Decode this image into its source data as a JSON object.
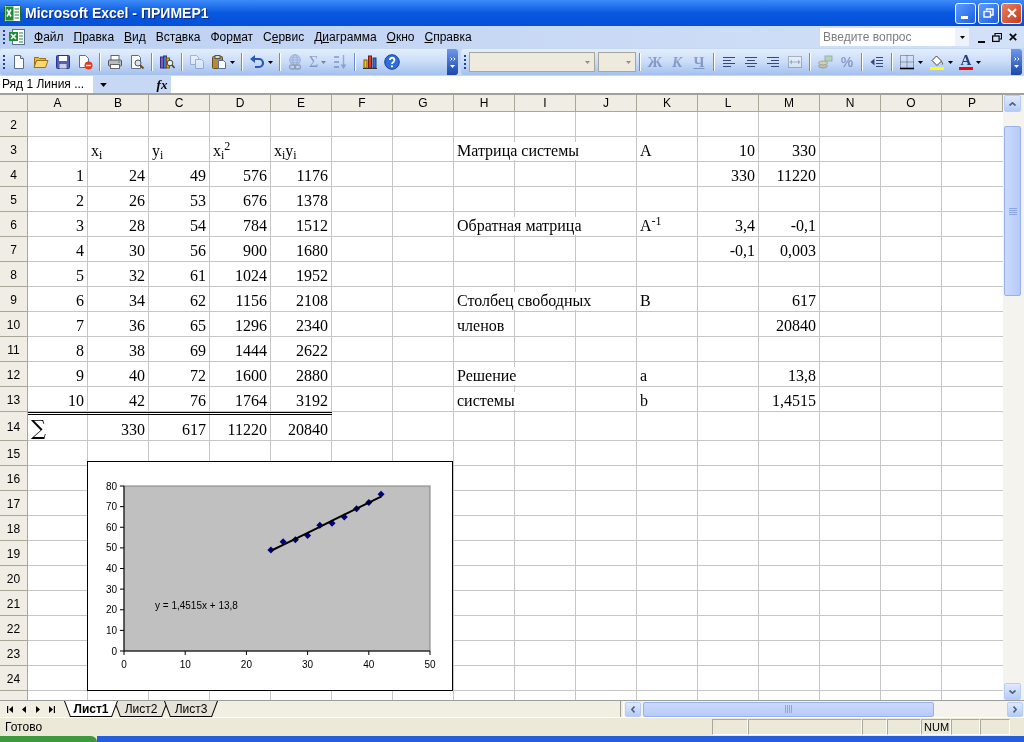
{
  "window": {
    "title": "Microsoft Excel - ПРИМЕР1"
  },
  "menu_bar": {
    "items": [
      {
        "key": "Ф",
        "post": "айл"
      },
      {
        "key": "П",
        "post": "равка"
      },
      {
        "key": "В",
        "post": "ид"
      },
      {
        "pre": "Вст",
        "key": "а",
        "post": "вка"
      },
      {
        "pre": "Фор",
        "key": "м",
        "post": "ат"
      },
      {
        "pre": "С",
        "key": "е",
        "post": "рвис"
      },
      {
        "pre": "Д",
        "key": "и",
        "post": "аграмма"
      },
      {
        "key": "О",
        "post": "кно"
      },
      {
        "key": "С",
        "post": "правка"
      }
    ],
    "question": {
      "placeholder": "Введите вопрос"
    }
  },
  "standard_toolbar": {
    "groups": [
      [
        {
          "disabled": false,
          "dropdown": false
        },
        {
          "disabled": false,
          "dropdown": false
        },
        {
          "disabled": false,
          "dropdown": false
        },
        {
          "disabled": false,
          "dropdown": false
        }
      ],
      [
        {
          "disabled": false,
          "dropdown": false
        },
        {
          "disabled": false,
          "dropdown": false
        }
      ],
      [
        {
          "disabled": false,
          "dropdown": false
        }
      ],
      [
        {
          "disabled": true,
          "dropdown": false
        },
        {
          "disabled": false,
          "dropdown": true
        }
      ],
      [
        {
          "disabled": false,
          "dropdown": true
        }
      ],
      [
        {
          "disabled": true,
          "dropdown": false
        },
        {
          "disabled": true,
          "dropdown": true,
          "label": "Σ"
        },
        {
          "disabled": true,
          "dropdown": false
        }
      ],
      [
        {
          "disabled": false,
          "dropdown": false
        },
        {
          "disabled": false,
          "dropdown": false
        }
      ]
    ]
  },
  "formatting_toolbar": {
    "font_name": {
      "disabled": true
    },
    "font_size": {
      "disabled": true
    },
    "groups": [
      [
        {
          "disabled": true,
          "dropdown": false,
          "label": "Ж"
        },
        {
          "disabled": true,
          "dropdown": false,
          "label": "К"
        },
        {
          "disabled": true,
          "dropdown": false,
          "label": "Ч"
        }
      ],
      [
        {
          "disabled": false,
          "dropdown": false
        },
        {
          "disabled": false,
          "dropdown": false
        },
        {
          "disabled": false,
          "dropdown": false
        },
        {
          "disabled": true,
          "dropdown": false
        }
      ],
      [
        {
          "disabled": true,
          "dropdown": false
        },
        {
          "disabled": true,
          "dropdown": false,
          "label": "%"
        }
      ],
      [
        {
          "disabled": false,
          "dropdown": false
        }
      ],
      [
        {
          "disabled": false,
          "dropdown": true
        },
        {
          "disabled": false,
          "dropdown": true
        },
        {
          "disabled": false,
          "dropdown": true,
          "label": "A"
        }
      ]
    ]
  },
  "formula_bar": {
    "name_box": "Ряд 1 Линия ...",
    "function_label": "fx"
  },
  "sheet": {
    "columns": [
      "A",
      "B",
      "C",
      "D",
      "E",
      "F",
      "G",
      "H",
      "I",
      "J",
      "K",
      "L",
      "M",
      "N",
      "O",
      "P"
    ],
    "rows": [
      "2",
      "3",
      "4",
      "5",
      "6",
      "7",
      "8",
      "9",
      "10",
      "11",
      "12",
      "13",
      "14",
      "15",
      "16",
      "17",
      "18",
      "19",
      "20",
      "21",
      "22",
      "23",
      "24"
    ]
  },
  "data_table": {
    "header": [
      "x$_{i}$",
      "y$_{i}$",
      "x$_{i}$$^{2}$",
      "x$_{i}$y$_{i}$"
    ],
    "rows": [
      [
        "1",
        "24",
        "49",
        "576",
        "1176"
      ],
      [
        "2",
        "26",
        "53",
        "676",
        "1378"
      ],
      [
        "3",
        "28",
        "54",
        "784",
        "1512"
      ],
      [
        "4",
        "30",
        "56",
        "900",
        "1680"
      ],
      [
        "5",
        "32",
        "61",
        "1024",
        "1952"
      ],
      [
        "6",
        "34",
        "62",
        "1156",
        "2108"
      ],
      [
        "7",
        "36",
        "65",
        "1296",
        "2340"
      ],
      [
        "8",
        "38",
        "69",
        "1444",
        "2622"
      ],
      [
        "9",
        "40",
        "72",
        "1600",
        "2880"
      ],
      [
        "10",
        "42",
        "76",
        "1764",
        "3192"
      ]
    ],
    "total": {
      "symbol": "∑",
      "values": [
        "330",
        "617",
        "11220",
        "20840"
      ]
    }
  },
  "system": [
    {
      "kind": "matrix",
      "label_lines": [
        "Матрица системы"
      ],
      "symbols": [
        "A"
      ],
      "rows": [
        [
          "10",
          "330"
        ],
        [
          "330",
          "11220"
        ]
      ]
    },
    {
      "kind": "matrix",
      "label_lines": [
        "Обратная матрица"
      ],
      "symbols": [
        "A$^{-1}$"
      ],
      "rows": [
        [
          "3,4",
          "-0,1"
        ],
        [
          "-0,1",
          "0,003"
        ]
      ]
    },
    {
      "kind": "vector",
      "label_lines": [
        "Столбец свободных",
        "членов"
      ],
      "symbols": [
        "B"
      ],
      "rows": [
        [
          "617"
        ],
        [
          "20840"
        ]
      ]
    },
    {
      "kind": "vector",
      "label_lines": [
        "Решение",
        "системы"
      ],
      "symbols": [
        "a",
        "b"
      ],
      "rows": [
        [
          "13,8"
        ],
        [
          "1,4515"
        ]
      ]
    }
  ],
  "chart": {
    "chart_data": {
      "type": "scatter",
      "x": [
        24,
        26,
        28,
        30,
        32,
        34,
        36,
        38,
        40,
        42
      ],
      "series": [
        {
          "type": "scatter",
          "color": "#000080",
          "values": [
            49,
            53,
            54,
            56,
            61,
            62,
            65,
            69,
            72,
            76
          ]
        },
        {
          "type": "line",
          "color": "#000000",
          "values": [
            48.6,
            51.5,
            54.4,
            57.3,
            60.2,
            63.2,
            66.1,
            69,
            71.9,
            74.8
          ]
        }
      ],
      "xlim": [
        0,
        50
      ],
      "ylim": [
        0,
        80
      ],
      "xticks": [
        0,
        10,
        20,
        30,
        40,
        50
      ],
      "yticks": [
        0,
        10,
        20,
        30,
        40,
        50,
        60,
        70,
        80
      ],
      "annotations": [
        "y = 1,4515x + 13,8"
      ]
    }
  },
  "sheet_tabs": [
    {
      "label": "Лист1",
      "selected": true
    },
    {
      "label": "Лист2",
      "selected": false
    },
    {
      "label": "Лист3",
      "selected": false
    }
  ],
  "status_bar": {
    "text": "Готово",
    "indicators": [
      "NUM"
    ]
  }
}
